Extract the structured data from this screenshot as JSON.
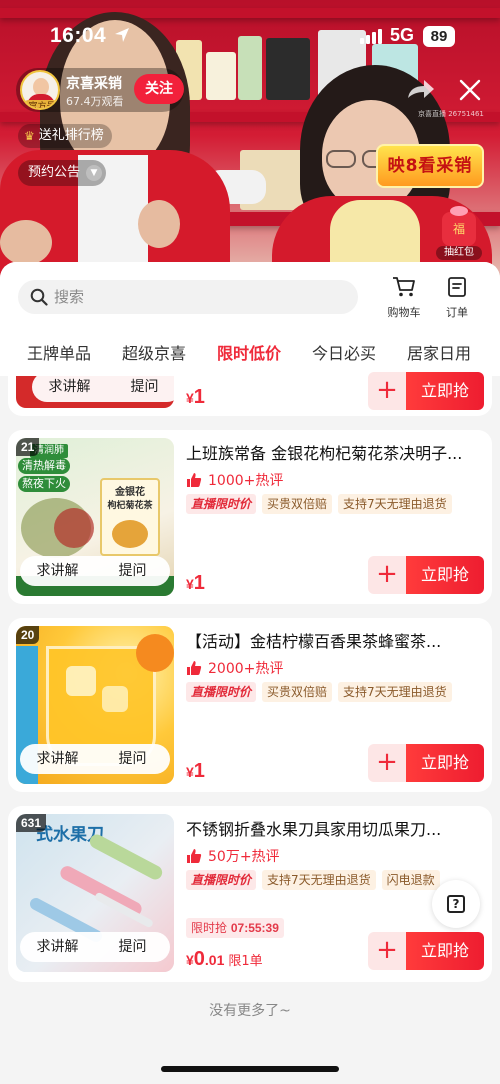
{
  "status_bar": {
    "time": "16:04",
    "network": "5G",
    "battery": "89"
  },
  "anchor": {
    "name": "京喜采销",
    "views": "67.4万观看",
    "badge": "官方号",
    "follow_label": "关注",
    "room_id": "京喜直播 26751461"
  },
  "live": {
    "rank_label": "送礼排行榜",
    "notice_label": "预约公告",
    "banner_text": "映8看采销",
    "redpack_char": "福",
    "redpack_label": "抽红包"
  },
  "sheet": {
    "search_placeholder": "搜索",
    "cart_label": "购物车",
    "order_label": "订单",
    "tabs": [
      "王牌单品",
      "超级京喜",
      "限时低价",
      "今日必买",
      "居家日用"
    ],
    "active_tab": 2
  },
  "products": [
    {
      "rank": "",
      "title": "",
      "hot": "",
      "price_int": "1",
      "ask_label": "求讲解",
      "question_label": "提问",
      "buy_label": "立即抢",
      "plus": "+"
    },
    {
      "rank": "21",
      "thumb_labels": [
        "清润肺",
        "清热解毒",
        "熬夜下火",
        "金银花",
        "枸杞菊花茶"
      ],
      "title": "上班族常备 金银花枸杞菊花茶决明子...",
      "hot": "1000+热评",
      "tags": [
        "直播限时价",
        "买贵双倍赔",
        "支持7天无理由退货"
      ],
      "price_int": "1",
      "ask_label": "求讲解",
      "question_label": "提问",
      "buy_label": "立即抢",
      "plus": "+"
    },
    {
      "rank": "20",
      "title": "【活动】金桔柠檬百香果茶蜂蜜茶...",
      "hot": "2000+热评",
      "tags": [
        "直播限时价",
        "买贵双倍赔",
        "支持7天无理由退货"
      ],
      "price_int": "1",
      "ask_label": "求讲解",
      "question_label": "提问",
      "buy_label": "立即抢",
      "plus": "+"
    },
    {
      "rank": "631",
      "thumb_caption": "式水果刀",
      "title": "不锈钢折叠水果刀具家用切瓜果刀...",
      "hot": "50万+热评",
      "tags": [
        "直播限时价",
        "支持7天无理由退货",
        "闪电退款"
      ],
      "flash_label": "限时抢",
      "flash_time": "07:55:39",
      "price_int": "0",
      "price_dec": ".01",
      "price_unit": "限1单",
      "ask_label": "求讲解",
      "question_label": "提问",
      "buy_label": "立即抢",
      "plus": "+"
    }
  ],
  "currency": "¥",
  "end_text": "没有更多了~",
  "colors": {
    "accent": "#ef2a3a",
    "brand_red": "#d31c34"
  }
}
